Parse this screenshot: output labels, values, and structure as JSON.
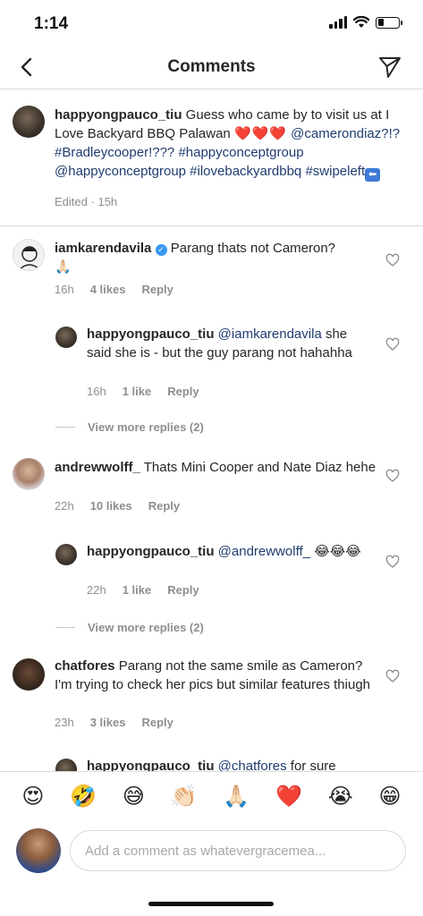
{
  "status_bar": {
    "time": "1:14"
  },
  "header": {
    "title": "Comments"
  },
  "caption": {
    "username": "happyongpauco_tiu",
    "text_1": "Guess who came by to visit us at I Love Backyard BBQ Palawan",
    "hearts": "❤️❤️❤️",
    "tags": [
      "@camerondiaz?!?",
      "#Bradleycooper!???",
      "#happyconceptgroup",
      "@happyconceptgroup",
      "#ilovebackyardbbq",
      "#swipeleft"
    ],
    "arrow_emoji": "⬅",
    "edited": "Edited",
    "dot": "·",
    "time": "15h"
  },
  "comments": [
    {
      "username": "iamkarendavila",
      "text": "Parang thats not Cameron?",
      "emoji": "🙏🏻",
      "time": "16h",
      "likes": "4 likes",
      "reply": "Reply",
      "verified_mark": "✓"
    },
    {
      "username": "happyongpauco_tiu",
      "mention": "@iamkarendavila",
      "text": "she said she is - but the guy parang not hahahha",
      "time": "16h",
      "likes": "1 like",
      "reply": "Reply"
    },
    {
      "view_more": "View more replies (2)"
    },
    {
      "username": "andrewwolff_",
      "text": "Thats Mini Cooper and Nate Diaz hehe",
      "time": "22h",
      "likes": "10 likes",
      "reply": "Reply"
    },
    {
      "username": "happyongpauco_tiu",
      "mention": "@andrewwolff_",
      "text": "😂😂😂",
      "time": "22h",
      "likes": "1 like",
      "reply": "Reply"
    },
    {
      "view_more": "View more replies (2)"
    },
    {
      "username": "chatfores",
      "text": "Parang not the same smile as Cameron? I'm trying to check her pics but similar features thiugh",
      "time": "23h",
      "likes": "3 likes",
      "reply": "Reply"
    },
    {
      "username": "happyongpauco_tiu",
      "mention": "@chatfores",
      "text": "for sure"
    }
  ],
  "emoji_bar": [
    "😍",
    "🤣",
    "😅",
    "👏🏻",
    "🙏🏻",
    "❤️",
    "😭",
    "😁"
  ],
  "composer": {
    "placeholder": "Add a comment as whatevergracemea..."
  },
  "colors": {
    "link": "#1f3c70",
    "meta_gray": "#8e8e8e",
    "verified": "#3897f0",
    "heart_red": "#ed2a3d"
  },
  "icons": {
    "back": "chevron-left-icon",
    "send": "paper-plane-icon",
    "like": "heart-outline-icon"
  }
}
